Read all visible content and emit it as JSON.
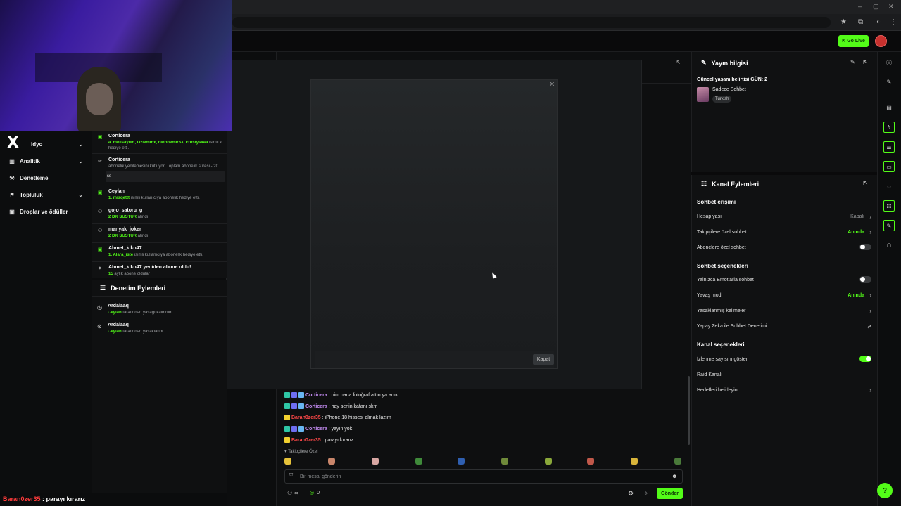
{
  "browser": {
    "window_controls": [
      "–",
      "▢",
      "✕"
    ],
    "icons": [
      "star-icon",
      "extension-icon",
      "profile-icon",
      "menu-icon"
    ]
  },
  "header": {
    "go_live_label": "Go Live",
    "colors": {
      "accent": "#53fc18"
    }
  },
  "left_nav": {
    "logo_text": "X",
    "items": [
      {
        "label": "idyo",
        "icon": "video-icon",
        "has_chevron": true
      },
      {
        "label": "Analitik",
        "icon": "chart-icon",
        "has_chevron": true
      },
      {
        "label": "Denetleme",
        "icon": "hammer-icon",
        "has_chevron": false
      },
      {
        "label": "Topluluk",
        "icon": "community-icon",
        "has_chevron": true
      },
      {
        "label": "Droplar ve ödüller",
        "icon": "gift-icon",
        "has_chevron": false
      }
    ]
  },
  "overlay_caption": {
    "user": "Baran0zer35",
    "text": " : parayı kırarız"
  },
  "activity_feed": {
    "items": [
      {
        "icon": "gift-icon",
        "title": "Corticera",
        "sub_highlight": "4. melisaylim, Ozlemmx, bidonemir33, Frostys444",
        "sub": " isimli k",
        "sub2": "hediye etti."
      },
      {
        "icon": "sub-icon",
        "title": "Corticera",
        "sub_highlight": "",
        "sub": "abonelik yenilemesini kutluyor! Toplam abonelik süresi - 20",
        "input": "ss"
      },
      {
        "icon": "gift-icon",
        "title": "Ceylan",
        "sub_highlight": "1. misqettt",
        "sub": " isimli kullanıcıya abonelik hediye etti."
      },
      {
        "icon": "timeout-icon",
        "title": "gojo_satoru_g",
        "sub_highlight": "2 DK SUSTUR",
        "sub": " alındı"
      },
      {
        "icon": "timeout-icon",
        "title": "manyak_joker",
        "sub_highlight": "2 DK SUSTUR",
        "sub": " alındı"
      },
      {
        "icon": "gift-icon",
        "title": "Ahmet_klkn47",
        "sub_highlight": "1. Alara_iste",
        "sub": " isimli kullanıcıya abonelik hediye etti."
      },
      {
        "icon": "star-icon",
        "title": "Ahmet_klkn47 yeniden abone oldu!",
        "sub_highlight": "15",
        "sub": " aylık abone oldular"
      }
    ]
  },
  "moderation": {
    "title": "Denetim Eylemleri",
    "items": [
      {
        "icon": "clock-icon",
        "title": "Ardalaaq",
        "actor": "Ceylan",
        "action": " tarafından yasağı kaldırıldı"
      },
      {
        "icon": "ban-icon",
        "title": "Ardalaaq",
        "actor": "Ceylan",
        "action": " tarafından yasaklandı"
      }
    ]
  },
  "modal": {
    "close_label": "Kapat",
    "close_x": "✕"
  },
  "chat": {
    "messages": [
      {
        "user": "Corticera",
        "text": ": oim bana fotoğraf attın ya amk",
        "badges": [
          "b1",
          "b2",
          "b3"
        ],
        "color": "c"
      },
      {
        "user": "Corticera",
        "text": ": hay senin kafanı skm",
        "badges": [
          "b1",
          "b2",
          "b3"
        ],
        "color": "c"
      },
      {
        "user": "Baran0zer35",
        "text": ": iPhone 18 hissesi almak lazım",
        "badges": [
          "b4"
        ],
        "color": "b"
      },
      {
        "user": "Corticera",
        "text": ": yayın yok",
        "badges": [
          "b1",
          "b2",
          "b3"
        ],
        "color": "c"
      },
      {
        "user": "Baran0zer35",
        "text": ": parayı kıranz",
        "badges": [
          "b4"
        ],
        "color": "b"
      }
    ],
    "followers_only": "♥ Takipçilere Özel",
    "input_placeholder": "Bir mesaj gönderin",
    "points_label": "∞",
    "gift_count": "0",
    "send_label": "Gönder"
  },
  "stream_info": {
    "title": "Yayın bilgisi",
    "stream_title": "Güncel yaşam belirtisi GÜN: 2",
    "category": "Sadece Sohbet",
    "language": "Turkish"
  },
  "channel_actions": {
    "title": "Kanal Eylemleri",
    "chat_access": {
      "title": "Sohbet erişimi",
      "rows": [
        {
          "label": "Hesap yaşı",
          "value": "Kapalı",
          "value_style": "muted",
          "control": "arrow"
        },
        {
          "label": "Takipçilere özel sohbet",
          "value": "Anında",
          "value_style": "green",
          "control": "arrow"
        },
        {
          "label": "Abonelere özel sohbet",
          "value": "",
          "control": "toggle",
          "on": false
        }
      ]
    },
    "chat_options": {
      "title": "Sohbet seçenekleri",
      "rows": [
        {
          "label": "Yalnızca Emotlarla sohbet",
          "value": "",
          "control": "toggle",
          "on": false
        },
        {
          "label": "Yavaş mod",
          "value": "Anında",
          "value_style": "green",
          "control": "arrow"
        },
        {
          "label": "Yasaklanmış kelimeler",
          "value": "",
          "control": "arrow"
        },
        {
          "label": "Yapay Zeka ile Sohbet Denetimi",
          "value": "",
          "control": "external"
        }
      ]
    },
    "channel_options": {
      "title": "Kanal seçenekleri",
      "rows": [
        {
          "label": "İzlenme sayısını göster",
          "value": "",
          "control": "toggle",
          "on": true
        },
        {
          "label": "Raid Kanalı",
          "value": "",
          "control": "none"
        },
        {
          "label": "Hedefleri belirleyin",
          "value": "",
          "control": "arrow"
        }
      ]
    }
  },
  "rail": {
    "icons": [
      "info-icon",
      "pencil-icon",
      "layout-icon",
      "lightning-icon",
      "list-icon",
      "chat-icon",
      "code-icon",
      "dashboard-icon",
      "wrench-icon",
      "users-icon"
    ]
  }
}
